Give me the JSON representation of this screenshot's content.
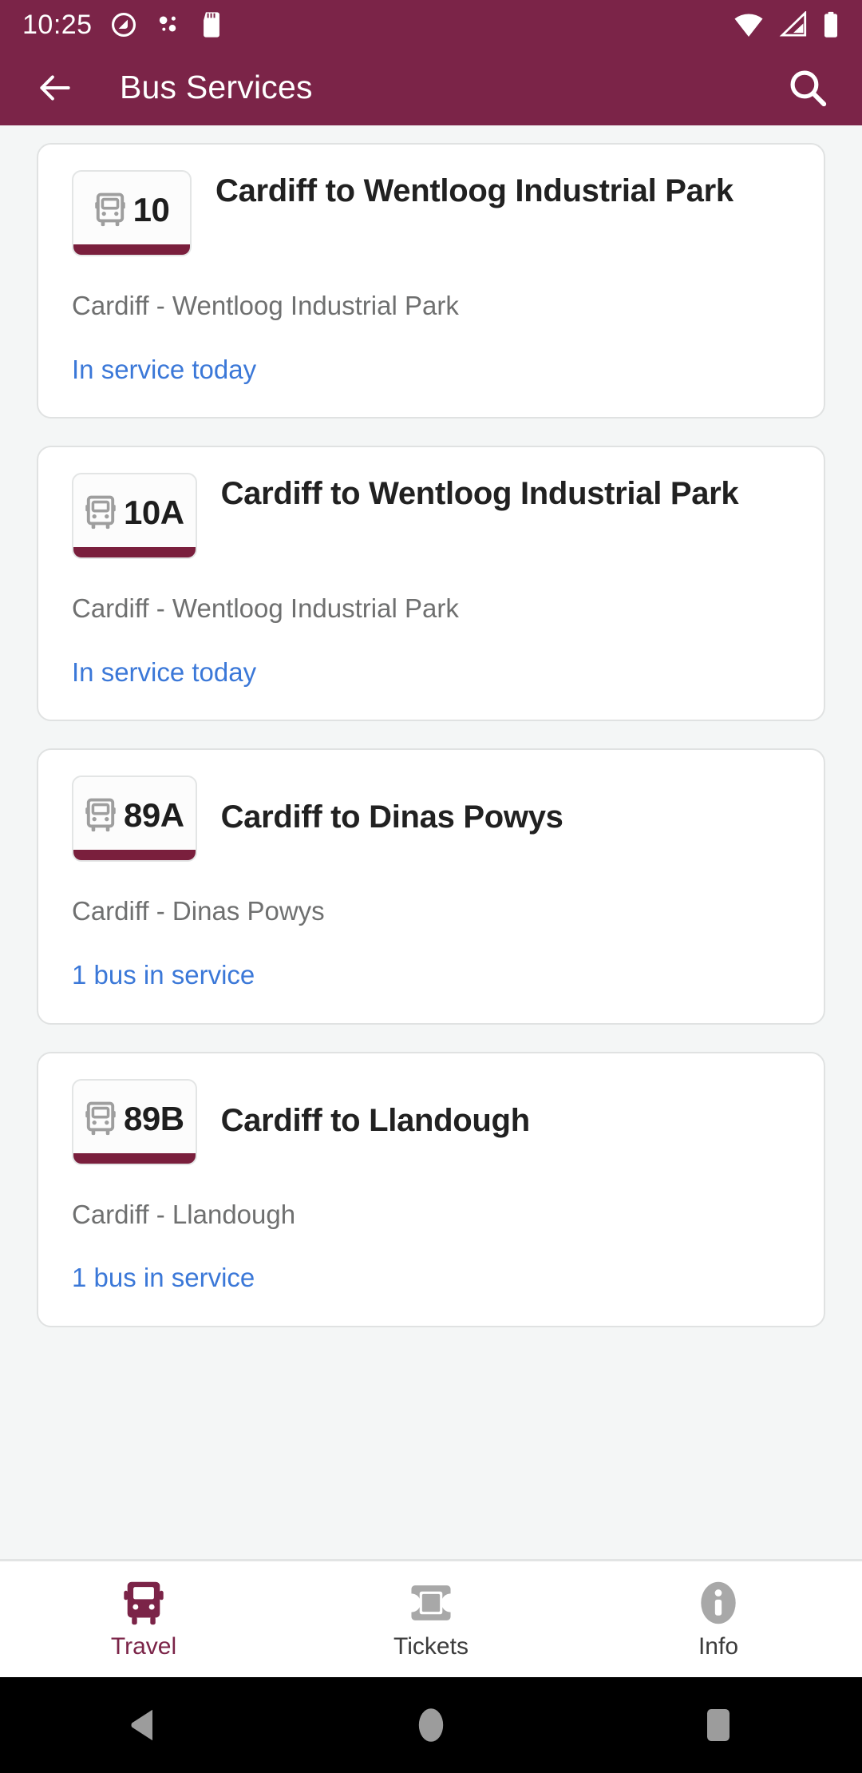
{
  "status_bar": {
    "time": "10:25",
    "icons_left": [
      "android-q-icon",
      "assistant-dots-icon",
      "sd-card-icon"
    ],
    "icons_right": [
      "wifi-icon",
      "cellular-signal-icon",
      "battery-icon"
    ],
    "background_color": "#7b2448",
    "foreground_color": "#ffffff"
  },
  "app_bar": {
    "back_icon": "back-arrow-icon",
    "title": "Bus Services",
    "search_icon": "search-icon",
    "background_color": "#7b2448"
  },
  "theme": {
    "brand": "#7b2448",
    "badge_bar": "#7a1f3d",
    "link": "#3b78d8",
    "page_background": "#f4f6f6",
    "card_background": "#ffffff",
    "card_border": "#e0e2e2",
    "subtitle": "#6f7070"
  },
  "services": [
    {
      "route": "10",
      "icon": "bus-icon",
      "title": "Cardiff to Wentloog Industrial Park",
      "subtitle": "Cardiff - Wentloog Industrial Park",
      "status": "In service today",
      "title_lines": 2
    },
    {
      "route": "10A",
      "icon": "bus-icon",
      "title": "Cardiff to Wentloog Industrial Park",
      "subtitle": "Cardiff - Wentloog Industrial Park",
      "status": "In service today",
      "title_lines": 2
    },
    {
      "route": "89A",
      "icon": "bus-icon",
      "title": "Cardiff to Dinas Powys",
      "subtitle": "Cardiff - Dinas Powys",
      "status": "1 bus in service",
      "title_lines": 1
    },
    {
      "route": "89B",
      "icon": "bus-icon",
      "title": "Cardiff to Llandough",
      "subtitle": "Cardiff - Llandough",
      "status": "1 bus in service",
      "title_lines": 1
    }
  ],
  "bottom_nav": {
    "items": [
      {
        "label": "Travel",
        "icon": "bus-icon",
        "active": true
      },
      {
        "label": "Tickets",
        "icon": "ticket-icon",
        "active": false
      },
      {
        "label": "Info",
        "icon": "info-icon",
        "active": false
      }
    ]
  },
  "android_nav": {
    "back": "triangle-back-icon",
    "home": "circle-home-icon",
    "recents": "square-recents-icon"
  }
}
